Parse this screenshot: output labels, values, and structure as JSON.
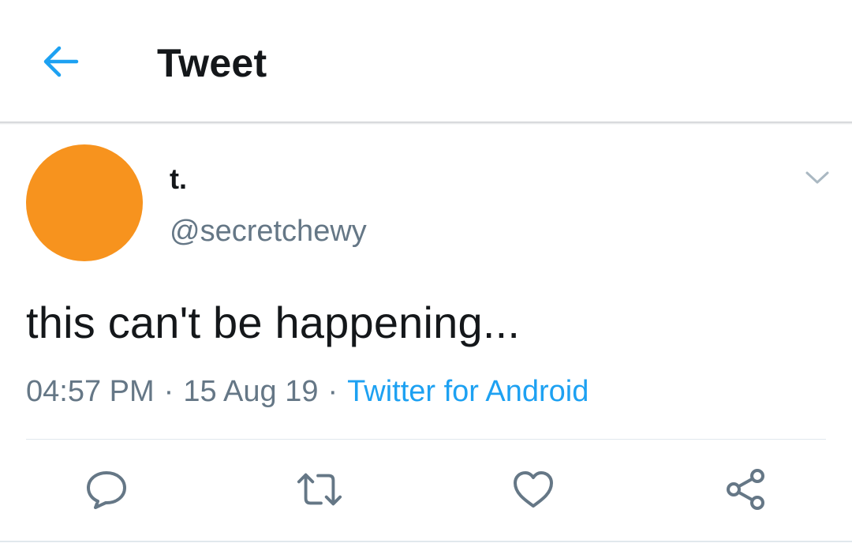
{
  "header": {
    "title": "Tweet",
    "back_icon": "arrow-left-icon"
  },
  "tweet": {
    "author": {
      "display_name": "t.",
      "handle": "@secretchewy",
      "avatar_color": "#f7931e"
    },
    "text": "this can't be happening...",
    "time": "04:57 PM",
    "date": "15 Aug 19",
    "separator": "·",
    "source": "Twitter for Android"
  },
  "actions": [
    {
      "name": "reply",
      "icon": "reply-icon"
    },
    {
      "name": "retweet",
      "icon": "retweet-icon"
    },
    {
      "name": "like",
      "icon": "heart-icon"
    },
    {
      "name": "share",
      "icon": "share-icon"
    }
  ],
  "colors": {
    "accent": "#1da1f2",
    "text": "#14171a",
    "secondary_text": "#657786",
    "divider": "#e1e8ed"
  }
}
